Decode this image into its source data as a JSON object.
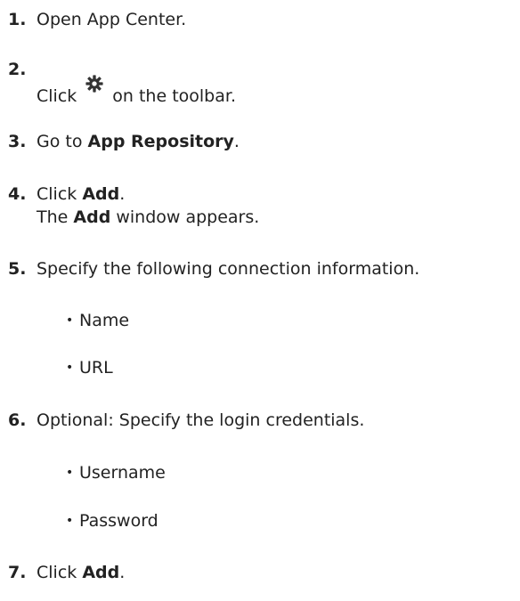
{
  "steps": [
    {
      "num": "1.",
      "pre": "Open App Center.",
      "bold": "",
      "post": ""
    },
    {
      "num": "2.",
      "pre": "Click",
      "icon": "gear-icon",
      "post": "on the toolbar."
    },
    {
      "num": "3.",
      "pre": "Go to ",
      "bold": "App Repository",
      "post": "."
    },
    {
      "num": "4.",
      "pre": "Click ",
      "bold": "Add",
      "post": ".",
      "line2_pre": "The ",
      "line2_bold": "Add",
      "line2_post": " window appears."
    },
    {
      "num": "5.",
      "pre": "Specify the following connection information.",
      "subs": [
        "Name",
        "URL"
      ]
    },
    {
      "num": "6.",
      "pre": "Optional: Specify the login credentials.",
      "subs": [
        "Username",
        "Password"
      ]
    },
    {
      "num": "7.",
      "pre": "Click ",
      "bold": "Add",
      "post": "."
    }
  ],
  "bullet_char": "•",
  "colors": {
    "text": "#222222",
    "icon": "#333333"
  }
}
